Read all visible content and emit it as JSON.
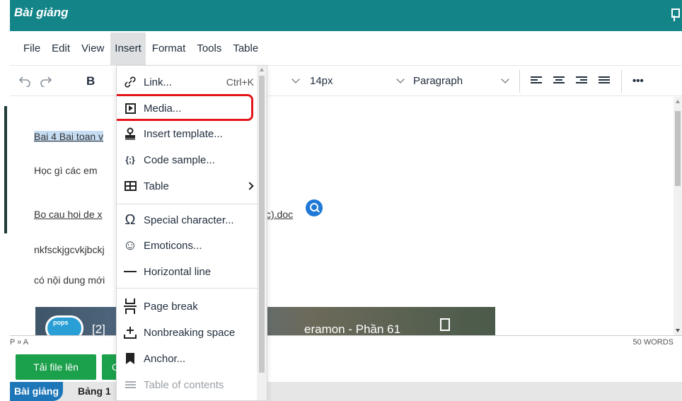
{
  "window": {
    "title": "Bài giảng"
  },
  "menubar": {
    "items": [
      "File",
      "Edit",
      "View",
      "Insert",
      "Format",
      "Tools",
      "Table"
    ],
    "active": "Insert"
  },
  "toolbar": {
    "bold_label": "B",
    "font_size": "14px",
    "block_format": "Paragraph",
    "more_label": "•••"
  },
  "content": {
    "line1": "Bai 4 Bai toan v",
    "line2": "Học gì các em",
    "line3_left": "Bo cau hoi de x",
    "line3_right": "c).doc",
    "line4": "nkfsckjgcvkjbckj",
    "line5": "có nội dung mới",
    "video_title_left": "[2]",
    "video_title_right": "eramon - Phần 61",
    "video_logo_text": "pops"
  },
  "statusbar": {
    "path": "P » A",
    "words": "50 WORDS"
  },
  "bottom": {
    "upload_label": "Tải file lên",
    "second_btn_label": "C"
  },
  "tabs": {
    "main": "Bài giảng",
    "second": "Bảng 1"
  },
  "insert_menu": {
    "items": [
      {
        "label": "Link...",
        "shortcut": "Ctrl+K",
        "icon": "link-icon"
      },
      {
        "label": "Media...",
        "icon": "media-icon",
        "highlighted": true
      },
      {
        "label": "Insert template...",
        "icon": "template-icon"
      },
      {
        "label": "Code sample...",
        "icon": "code-sample-icon"
      },
      {
        "label": "Table",
        "icon": "table-icon",
        "submenu": true
      },
      {
        "label": "Special character...",
        "icon": "omega-icon"
      },
      {
        "label": "Emoticons...",
        "icon": "emoticon-icon"
      },
      {
        "label": "Horizontal line",
        "icon": "horizontal-line-icon"
      },
      {
        "label": "Page break",
        "icon": "page-break-icon"
      },
      {
        "label": "Nonbreaking space",
        "icon": "nonbreaking-space-icon"
      },
      {
        "label": "Anchor...",
        "icon": "bookmark-icon"
      },
      {
        "label": "Table of contents",
        "icon": "toc-icon",
        "disabled": true
      }
    ],
    "icon_glyphs": {
      "link": "🔗",
      "template": "⚲",
      "code": "{;}",
      "omega": "Ω",
      "emoticon": "☺",
      "pagebreak": "⌶",
      "nbsp": "±"
    }
  },
  "colors": {
    "titlebar": "#138589",
    "upload_button": "#1ba04b",
    "highlight_border": "#e3141a",
    "tab_active": "#1d76b8"
  }
}
